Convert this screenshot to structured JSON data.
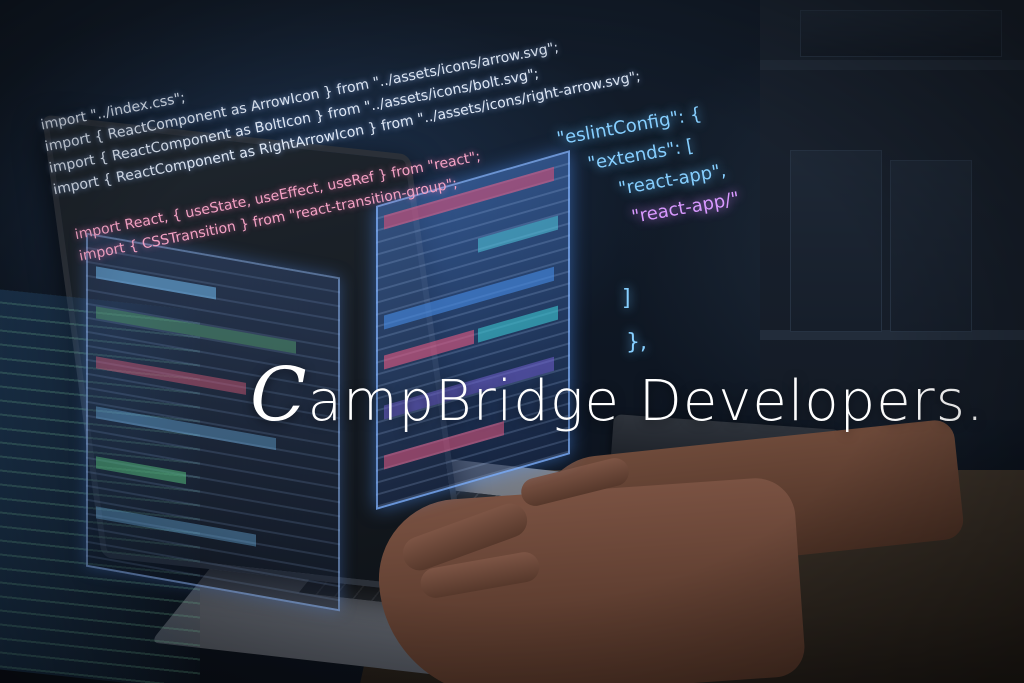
{
  "brand": {
    "text": "CampBridge Developers.",
    "initial": "C",
    "rest": "ampBridge Developers."
  },
  "code": {
    "imports": [
      "import \"../index.css\";",
      "import { ReactComponent as ArrowIcon } from \"../assets/icons/arrow.svg\";",
      "import { ReactComponent as BoltIcon } from \"../assets/icons/bolt.svg\";",
      "import { ReactComponent as RightArrowIcon } from \"../assets/icons/right-arrow.svg\";"
    ],
    "react_imports": [
      "import React, { useState, useEffect, useRef } from \"react\";",
      "import { CSSTransition } from \"react-transition-group\";"
    ],
    "eslint": [
      "\"eslintConfig\": {",
      "\"extends\": [",
      "\"react-app\",",
      "\"react-app/\""
    ],
    "close_bracket": "]",
    "close_brace": "},"
  },
  "colors": {
    "code_blue": "#86cfff",
    "code_pink": "#f4a2c4",
    "code_purple": "#d999ff",
    "brand_text": "#ffffff"
  }
}
